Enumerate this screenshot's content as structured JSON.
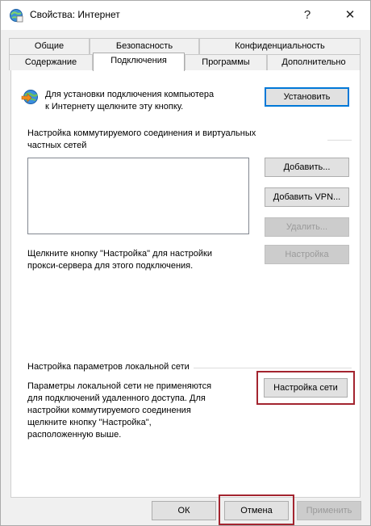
{
  "window": {
    "title": "Свойства: Интернет",
    "help_glyph": "?",
    "close_glyph": "✕"
  },
  "tabs": {
    "row1": [
      "Общие",
      "Безопасность",
      "Конфиденциальность"
    ],
    "row2": [
      "Содержание",
      "Подключения",
      "Программы",
      "Дополнительно"
    ],
    "active": "Подключения"
  },
  "setup": {
    "text_line1": "Для установки подключения компьютера",
    "text_line2": "к Интернету щелкните эту кнопку.",
    "button": "Установить"
  },
  "dialup": {
    "heading_line1": "Настройка коммутируемого соединения и виртуальных",
    "heading_line2": "частных сетей",
    "buttons": {
      "add": "Добавить...",
      "add_vpn": "Добавить VPN...",
      "remove": "Удалить...",
      "settings": "Настройка"
    },
    "proxy_line1": "Щелкните кнопку \"Настройка\" для настройки",
    "proxy_line2": "прокси-сервера для этого подключения."
  },
  "lan": {
    "heading": "Настройка параметров локальной сети",
    "desc_lines": [
      "Параметры локальной сети не применяются",
      "для подключений удаленного доступа. Для",
      "настройки коммутируемого соединения",
      "щелкните кнопку \"Настройка\",",
      "расположенную выше."
    ],
    "button": "Настройка сети"
  },
  "footer": {
    "ok": "ОК",
    "cancel": "Отмена",
    "apply": "Применить"
  },
  "colors": {
    "highlight": "#a3242f",
    "accent": "#0078d7"
  },
  "icons": {
    "title": "internet-options-icon",
    "setup": "globe-arrow-icon"
  }
}
